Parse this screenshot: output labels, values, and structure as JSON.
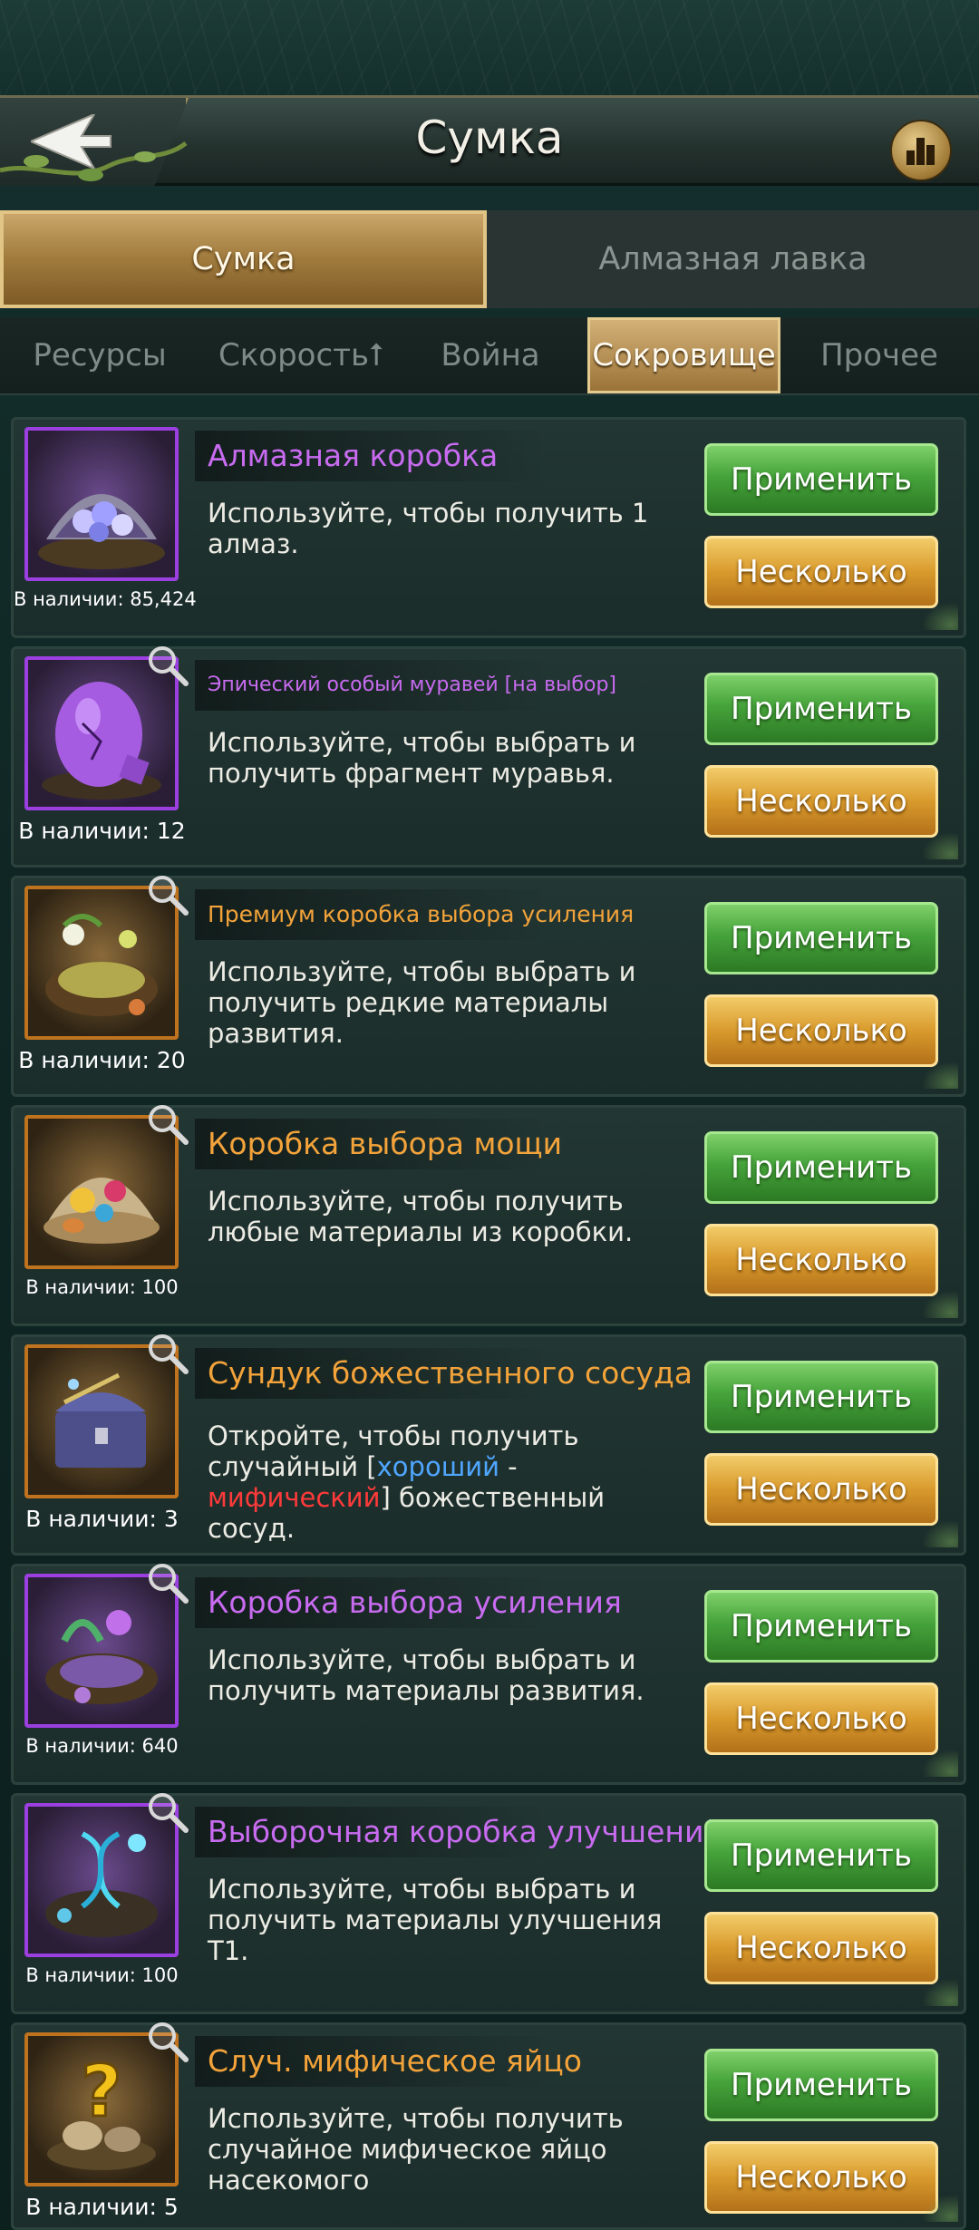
{
  "header": {
    "title": "Сумка"
  },
  "main_tabs": [
    {
      "label": "Сумка",
      "active": true
    },
    {
      "label": "Алмазная лавка",
      "active": false
    }
  ],
  "sub_tabs": [
    {
      "label": "Ресурсы",
      "active": false
    },
    {
      "label": "Скорость⭡",
      "active": false
    },
    {
      "label": "Война",
      "active": false
    },
    {
      "label": "Сокровище",
      "active": true
    },
    {
      "label": "Прочее",
      "active": false
    }
  ],
  "buttons": {
    "apply": "Применить",
    "multiple": "Несколько"
  },
  "items": [
    {
      "name": "Алмазная коробка",
      "rarity_color": "#c86bf0",
      "description": "Используйте, чтобы получить 1 алмаз.",
      "count": "В наличии: 85,424",
      "icon": "diamond-shell-icon"
    },
    {
      "name": "Эпический особый муравей [на выбор]",
      "rarity_color": "#c86bf0",
      "description": "Используйте, чтобы выбрать и получить фрагмент муравья.",
      "count": "В наличии: 12",
      "icon": "purple-egg-icon"
    },
    {
      "name": "Премиум коробка выбора усиления",
      "rarity_color": "#f3a33a",
      "description": "Используйте, чтобы выбрать и получить редкие материалы развития.",
      "count": "В наличии: 20",
      "icon": "nest-flowers-icon"
    },
    {
      "name": "Коробка выбора мощи",
      "rarity_color": "#f3a33a",
      "description": "Используйте, чтобы получить любые материалы из коробки.",
      "count": "В наличии: 100",
      "icon": "shell-treasure-icon"
    },
    {
      "name": "Сундук божественного сосуда",
      "rarity_color": "#f3a33a",
      "description_parts": [
        "Откройте, чтобы получить случайный [",
        "хороший",
        " - ",
        "мифический",
        "] божественный сосуд."
      ],
      "count": "В наличии: 3",
      "icon": "chest-icon"
    },
    {
      "name": "Коробка выбора усиления",
      "rarity_color": "#c86bf0",
      "description": "Используйте, чтобы выбрать и получить материалы развития.",
      "count": "В наличии: 640",
      "icon": "nest-purple-icon"
    },
    {
      "name": "Выборочная коробка улучшений",
      "rarity_color": "#c86bf0",
      "description": "Используйте, чтобы выбрать и получить материалы улучшения T1.",
      "count": "В наличии: 100",
      "icon": "dna-nest-icon"
    },
    {
      "name": "Случ. мифическое яйцо",
      "rarity_color": "#f3a33a",
      "description": "Используйте, чтобы получить случайное мифическое яйцо насекомого",
      "count": "В наличии: 5",
      "icon": "question-egg-icon"
    }
  ]
}
